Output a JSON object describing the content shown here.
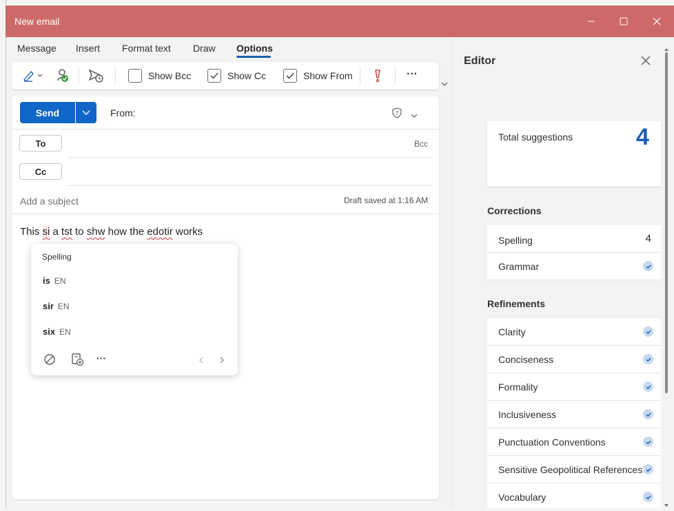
{
  "window": {
    "title": "New email"
  },
  "ribbon": {
    "tabs": [
      "Message",
      "Insert",
      "Format text",
      "Draw",
      "Options"
    ],
    "active_tab": "Options"
  },
  "toolbar": {
    "show_bcc": "Show Bcc",
    "show_cc": "Show Cc",
    "show_from": "Show From",
    "more": "···"
  },
  "compose": {
    "send_label": "Send",
    "from_label": "From:",
    "to_label": "To",
    "cc_label": "Cc",
    "bcc_link": "Bcc",
    "subject_placeholder": "Add a subject",
    "draft_status": "Draft saved at 1:16 AM",
    "body": {
      "w1": "This ",
      "w2": "si",
      "w3": " a ",
      "w4": "tst",
      "w5": " to ",
      "w6": "shw",
      "w7": " how the ",
      "w8": "edotir",
      "w9": " works"
    }
  },
  "spelling_popup": {
    "title": "Spelling",
    "suggestions": [
      {
        "word": "is",
        "lang": "EN"
      },
      {
        "word": "sir",
        "lang": "EN"
      },
      {
        "word": "six",
        "lang": "EN"
      }
    ],
    "more": "···"
  },
  "editor": {
    "title": "Editor",
    "total_label": "Total suggestions",
    "total_count": "4",
    "corrections_heading": "Corrections",
    "corrections": [
      {
        "label": "Spelling",
        "value": "4"
      },
      {
        "label": "Grammar"
      }
    ],
    "refinements_heading": "Refinements",
    "refinements": [
      {
        "label": "Clarity"
      },
      {
        "label": "Conciseness"
      },
      {
        "label": "Formality"
      },
      {
        "label": "Inclusiveness"
      },
      {
        "label": "Punctuation Conventions"
      },
      {
        "label": "Sensitive Geopolitical References"
      },
      {
        "label": "Vocabulary"
      }
    ]
  },
  "colors": {
    "titlebar": "#cd6a67",
    "send": "#1166c8",
    "accent": "#1a5fb4",
    "misspelling": "#d13438"
  }
}
